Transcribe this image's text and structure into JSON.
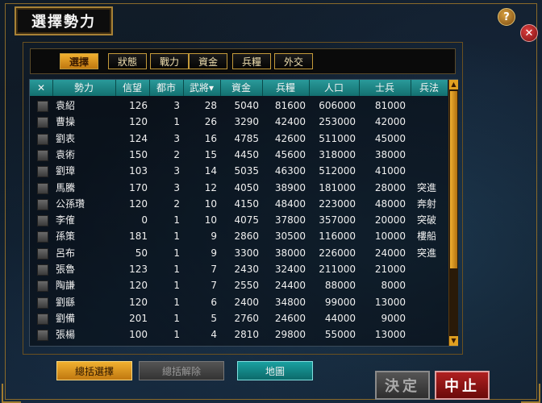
{
  "window": {
    "title": "選擇勢力"
  },
  "controls": {
    "help_icon": "?",
    "close_icon": "✕"
  },
  "tabs": [
    {
      "label": "選擇",
      "active": true
    },
    {
      "label": "狀態",
      "active": false
    },
    {
      "label": "戰力",
      "active": false
    },
    {
      "label": "資金",
      "active": false
    },
    {
      "label": "兵糧",
      "active": false
    },
    {
      "label": "外交",
      "active": false
    }
  ],
  "table": {
    "headers": [
      "✕",
      "勢力",
      "信望",
      "都市",
      "武將▾",
      "資金",
      "兵糧",
      "人口",
      "士兵",
      "兵法"
    ],
    "rows": [
      [
        "袁紹",
        "126",
        "3",
        "28",
        "5040",
        "81600",
        "606000",
        "81000",
        ""
      ],
      [
        "曹操",
        "120",
        "1",
        "26",
        "3290",
        "42400",
        "253000",
        "42000",
        ""
      ],
      [
        "劉表",
        "124",
        "3",
        "16",
        "4785",
        "42600",
        "511000",
        "45000",
        ""
      ],
      [
        "袁術",
        "150",
        "2",
        "15",
        "4450",
        "45600",
        "318000",
        "38000",
        ""
      ],
      [
        "劉璋",
        "103",
        "3",
        "14",
        "5035",
        "46300",
        "512000",
        "41000",
        ""
      ],
      [
        "馬騰",
        "170",
        "3",
        "12",
        "4050",
        "38900",
        "181000",
        "28000",
        "突進"
      ],
      [
        "公孫瓚",
        "120",
        "2",
        "10",
        "4150",
        "48400",
        "223000",
        "48000",
        "奔射"
      ],
      [
        "李傕",
        "0",
        "1",
        "10",
        "4075",
        "37800",
        "357000",
        "20000",
        "突破"
      ],
      [
        "孫策",
        "181",
        "1",
        "9",
        "2860",
        "30500",
        "116000",
        "10000",
        "樓船"
      ],
      [
        "呂布",
        "50",
        "1",
        "9",
        "3300",
        "38000",
        "226000",
        "24000",
        "突進"
      ],
      [
        "張魯",
        "123",
        "1",
        "7",
        "2430",
        "32400",
        "211000",
        "21000",
        ""
      ],
      [
        "陶謙",
        "120",
        "1",
        "7",
        "2550",
        "24400",
        "88000",
        "8000",
        ""
      ],
      [
        "劉繇",
        "120",
        "1",
        "6",
        "2400",
        "34800",
        "99000",
        "13000",
        ""
      ],
      [
        "劉備",
        "201",
        "1",
        "5",
        "2760",
        "24600",
        "44000",
        "9000",
        ""
      ],
      [
        "張楊",
        "100",
        "1",
        "4",
        "2810",
        "29800",
        "55000",
        "13000",
        ""
      ]
    ]
  },
  "buttons": {
    "select_all": "總括選擇",
    "clear_all": "總括解除",
    "map": "地圖",
    "confirm": "決定",
    "cancel": "中止"
  }
}
